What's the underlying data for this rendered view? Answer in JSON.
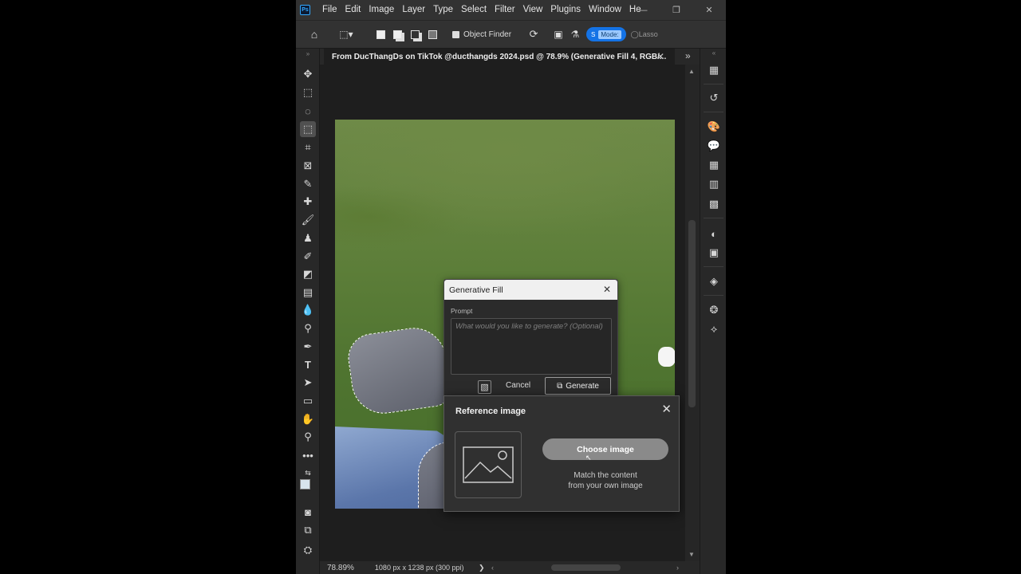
{
  "menu": {
    "logo": "Ps",
    "items": [
      "File",
      "Edit",
      "Image",
      "Layer",
      "Type",
      "Select",
      "Filter",
      "View",
      "Plugins",
      "Window",
      "He"
    ]
  },
  "window_controls": {
    "minimize": "—",
    "maximize": "❐",
    "close": "✕"
  },
  "options_bar": {
    "object_finder_label": "Object Finder",
    "pill_label": "S",
    "mode_label": "Mode:",
    "lasso_label": "Lasso"
  },
  "document": {
    "tab_title": "From DucThangDs on TikTok @ducthangds 2024.psd @ 78.9% (Generative Fill 4, RGB/...",
    "tab_close": "✕"
  },
  "status": {
    "zoom": "78.89%",
    "doc_info": "1080 px x 1238 px (300 ppi)",
    "arrow": "❯"
  },
  "generative_fill": {
    "title": "Generative Fill",
    "prompt_label": "Prompt",
    "prompt_placeholder": "What would you like to generate? (Optional)",
    "cancel_label": "Cancel",
    "generate_label": "Generate"
  },
  "reference_image": {
    "title": "Reference image",
    "choose_label": "Choose image",
    "description_line1": "Match the content",
    "description_line2": "from your own image"
  },
  "colors": {
    "accent": "#1473e6",
    "panel_bg": "#282828",
    "canvas_bg": "#1e1e1e"
  }
}
